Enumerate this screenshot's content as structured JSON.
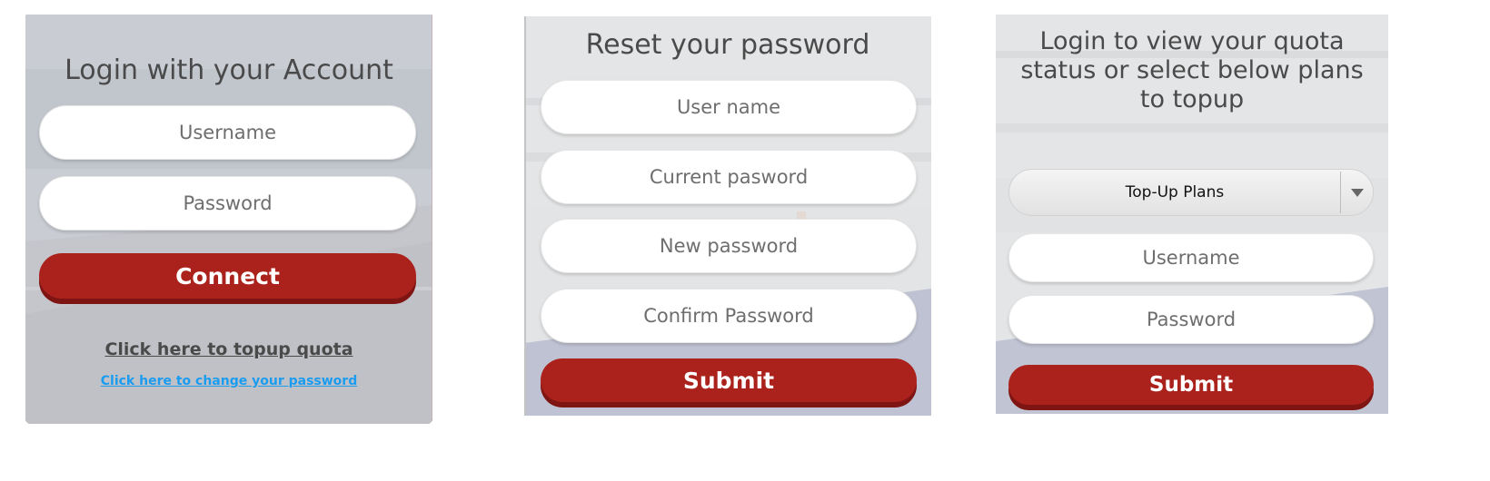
{
  "login_panel": {
    "title": "Login with your Account",
    "username_placeholder": "Username",
    "password_placeholder": "Password",
    "connect_label": "Connect",
    "topup_link": "Click here to topup quota",
    "change_password_link": "Click here to change your password"
  },
  "reset_panel": {
    "title": "Reset your password",
    "username_placeholder": "User name",
    "current_password_placeholder": "Current pasword",
    "new_password_placeholder": "New password",
    "confirm_password_placeholder": "Confirm Password",
    "submit_label": "Submit"
  },
  "quota_panel": {
    "title": "Login to view your quota status or select below plans to topup",
    "plan_select_value": "Top-Up Plans",
    "username_placeholder": "Username",
    "password_placeholder": "Password",
    "submit_label": "Submit"
  },
  "colors": {
    "accent_red": "#ab221d",
    "link_blue": "#1a9cf0",
    "title_gray": "#4a4a4a"
  },
  "icons": {
    "plan_select_arrow": "chevron-down-icon"
  }
}
